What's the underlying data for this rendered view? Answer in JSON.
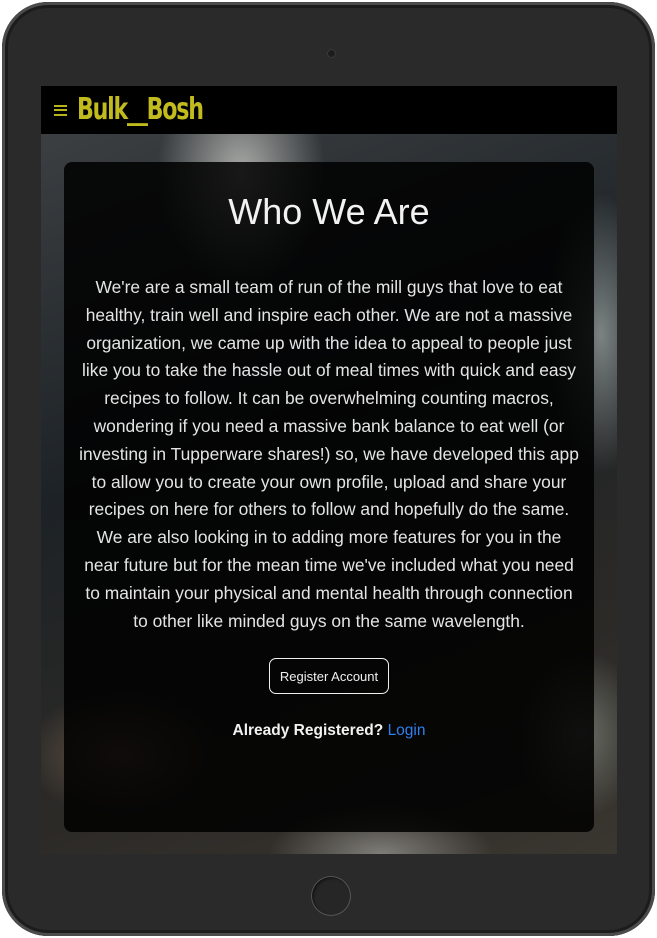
{
  "navbar": {
    "brand": "Bulk__Bosh",
    "menu_icon": "hamburger-menu-icon",
    "brand_color": "#c2bb1e"
  },
  "main": {
    "title": "Who We Are",
    "body": "We're are a small team of run of the mill guys that love to eat healthy, train well and inspire each other. We are not a massive organization, we came up with the idea to appeal to people just like you to take the hassle out of meal times with quick and easy recipes to follow. It can be overwhelming counting macros, wondering if you need a massive bank balance to eat well (or investing in Tupperware shares!) so, we have developed this app to allow you to create your own profile, upload and share your recipes on here for others to follow and hopefully do the same. We are also looking in to adding more features for you in the near future but for the mean time we've included what you need to maintain your physical and mental health through connection to other like minded guys on the same wavelength.",
    "register_button": "Register Account",
    "already_registered": "Already Registered?",
    "login_link": "Login",
    "link_color": "#2f7ff0"
  }
}
